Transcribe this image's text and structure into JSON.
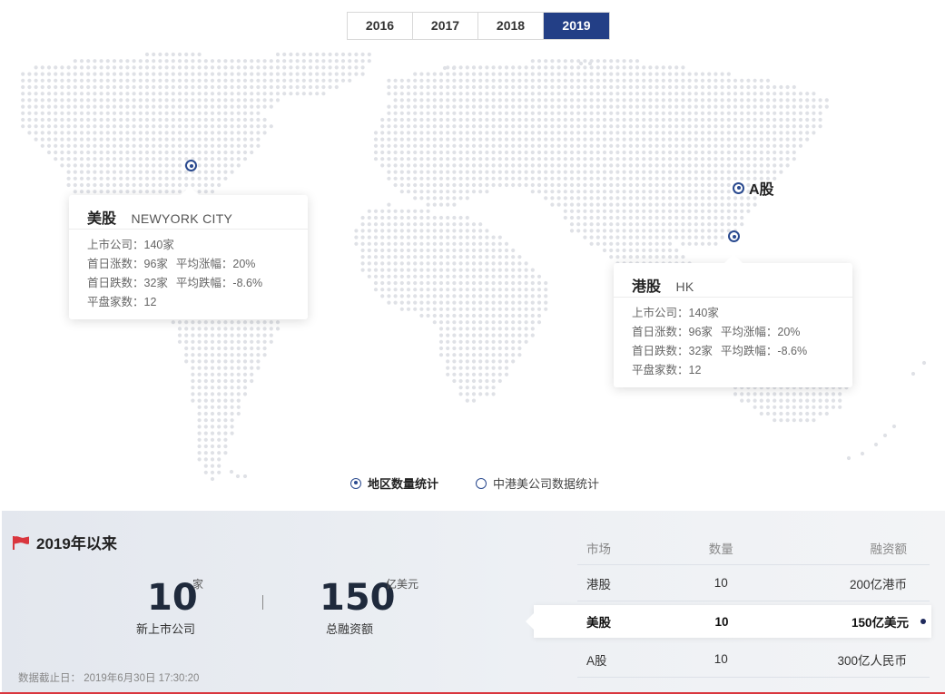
{
  "years": {
    "tabs": [
      "2016",
      "2017",
      "2018",
      "2019"
    ],
    "active": "2019"
  },
  "map": {
    "a_share_label": "A股",
    "us": {
      "title": "美股",
      "city": "NEWYORK CITY",
      "listed": "上市公司：140家",
      "rise_count": "首日涨数：96家",
      "rise_avg": "平均涨幅：20%",
      "fall_count": "首日跌数：32家",
      "fall_avg": "平均跌幅：-8.6%",
      "flat": "平盘家数：12"
    },
    "hk": {
      "title": "港股",
      "city": "HK",
      "listed": "上市公司：140家",
      "rise_count": "首日涨数：96家",
      "rise_avg": "平均涨幅：20%",
      "fall_count": "首日跌数：32家",
      "fall_avg": "平均跌幅：-8.6%",
      "flat": "平盘家数：12"
    }
  },
  "legend": {
    "region": "地区数量统计",
    "company": "中港美公司数据统计"
  },
  "stats": {
    "title": "2019年以来",
    "new_count": "10",
    "new_unit": "家",
    "new_caption": "新上市公司",
    "financing": "150",
    "financing_unit": "亿美元",
    "financing_caption": "总融资额",
    "footer_label": "数据截止日：",
    "footer_value": "2019年6月30日 17:30:20"
  },
  "table": {
    "headers": [
      "市场",
      "数量",
      "融资额"
    ],
    "rows": [
      {
        "market": "港股",
        "count": "10",
        "amount": "200亿港币",
        "active": false
      },
      {
        "market": "美股",
        "count": "10",
        "amount": "150亿美元",
        "active": true
      },
      {
        "market": "A股",
        "count": "10",
        "amount": "300亿人民币",
        "active": false
      }
    ]
  },
  "colors": {
    "accent": "#233f86",
    "dots": "#dfe1e6",
    "flag": "#d9363e"
  }
}
